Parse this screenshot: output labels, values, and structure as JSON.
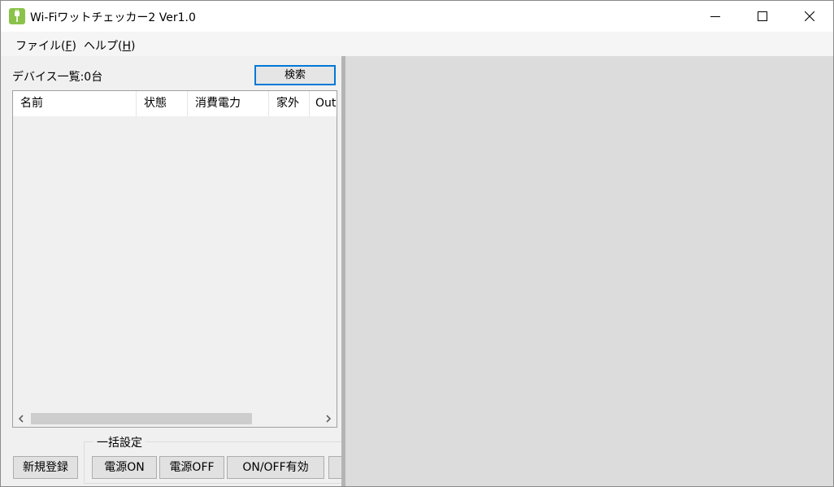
{
  "window": {
    "title": "Wi-Fiワットチェッカー2 Ver1.0",
    "icon": "app-plug-icon",
    "controls": [
      "minimize-icon",
      "maximize-icon",
      "close-icon"
    ]
  },
  "menu": {
    "file": {
      "label": "ファイル(",
      "accel": "F",
      "suffix": ")"
    },
    "help": {
      "label": "ヘルプ(",
      "accel": "H",
      "suffix": ")"
    }
  },
  "device_list": {
    "count_label": "デバイス一覧:0台",
    "search_label": "検索",
    "columns": [
      "名前",
      "状態",
      "消費電力",
      "家外",
      "Out"
    ]
  },
  "actions": {
    "new_register_label": "新規登録",
    "bulk_group_title": "一括設定",
    "power_on_label": "電源ON",
    "power_off_label": "電源OFF",
    "on_off_enable_label": "ON/OFF有効"
  },
  "colors": {
    "accent": "#0078d7",
    "app_icon": "#8bc34a",
    "right_panel": "#dcdcdc"
  }
}
